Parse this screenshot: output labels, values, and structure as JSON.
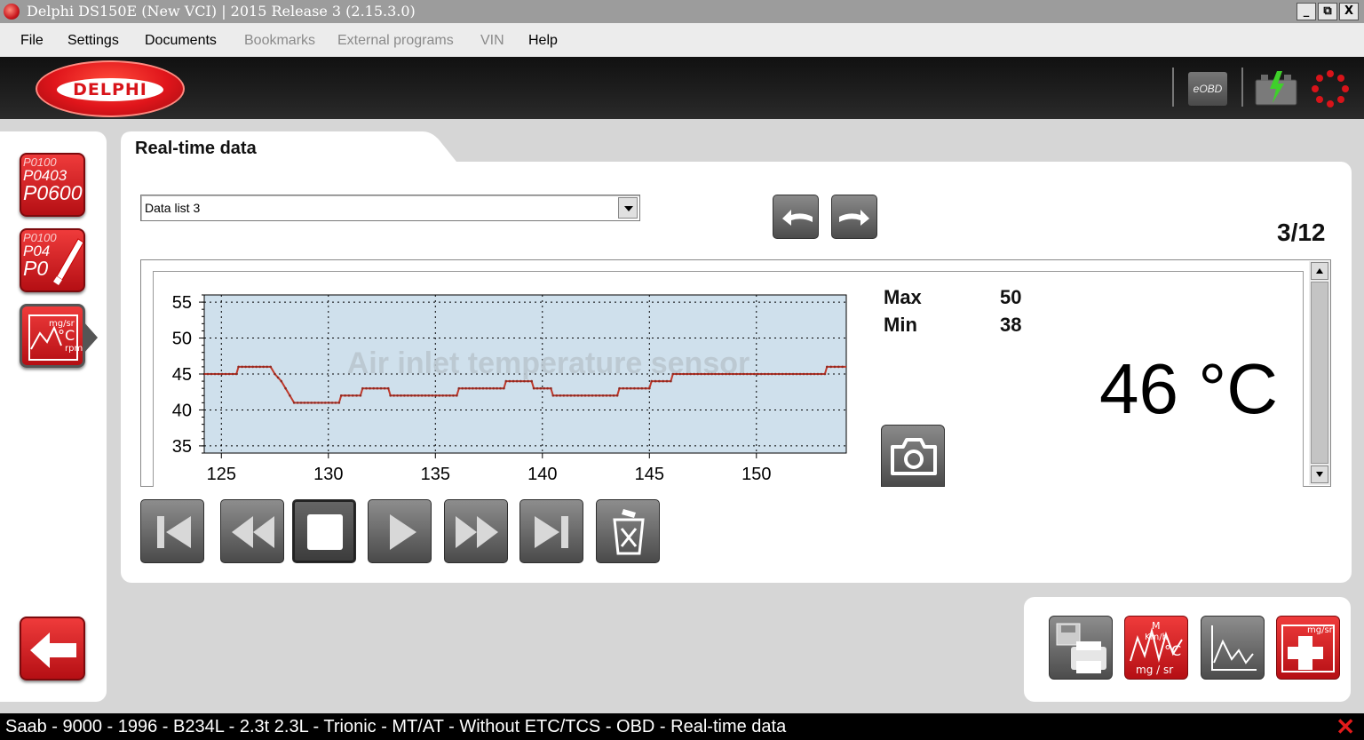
{
  "window": {
    "title": "Delphi DS150E (New VCI) | 2015 Release 3 (2.15.3.0)",
    "controls": [
      "_",
      "⧉",
      "X"
    ]
  },
  "menu": {
    "file": "File",
    "settings": "Settings",
    "documents": "Documents",
    "bookmarks": "Bookmarks",
    "external_programs": "External programs",
    "vin": "VIN",
    "help": "Help"
  },
  "header": {
    "logo_text": "DELPHI",
    "eobd_label": "eOBD"
  },
  "sidebar": {
    "dtc_button": {
      "codes": [
        "P0100",
        "P0403",
        "P0600"
      ]
    },
    "clear_dtc_button": {
      "codes": [
        "P0100",
        "P04",
        "P0"
      ]
    },
    "realtime_button": {
      "icon": "sensor-chart-icon"
    },
    "back_button": {
      "icon": "back-arrow-icon"
    }
  },
  "tab": {
    "title": "Real-time data"
  },
  "toolbar": {
    "data_list": "Data list 3",
    "page_counter": "3/12"
  },
  "sensor": {
    "name": "Air inlet temperature sensor",
    "max_label": "Max",
    "max_value": "50",
    "min_label": "Min",
    "min_value": "38",
    "current_value": "46 °C"
  },
  "chart_data": {
    "type": "line",
    "title": "Air inlet temperature sensor",
    "xlabel": "",
    "ylabel": "",
    "xlim": [
      124.2,
      154.2
    ],
    "ylim": [
      34,
      56
    ],
    "xticks": [
      125,
      130,
      135,
      140,
      145,
      150
    ],
    "yticks": [
      35,
      40,
      45,
      50,
      55
    ],
    "grid": true,
    "series": [
      {
        "color": "#c0392b",
        "points": [
          [
            124.2,
            45
          ],
          [
            125.7,
            45
          ],
          [
            125.8,
            46
          ],
          [
            127.3,
            46
          ],
          [
            127.5,
            45
          ],
          [
            127.8,
            44
          ],
          [
            128.0,
            43
          ],
          [
            128.2,
            42
          ],
          [
            128.4,
            41
          ],
          [
            130.5,
            41
          ],
          [
            130.6,
            42
          ],
          [
            131.5,
            42
          ],
          [
            131.6,
            43
          ],
          [
            132.8,
            43
          ],
          [
            132.9,
            42
          ],
          [
            136.0,
            42
          ],
          [
            136.1,
            43
          ],
          [
            138.2,
            43
          ],
          [
            138.3,
            44
          ],
          [
            139.5,
            44
          ],
          [
            139.6,
            43
          ],
          [
            140.4,
            43
          ],
          [
            140.5,
            42
          ],
          [
            143.5,
            42
          ],
          [
            143.6,
            43
          ],
          [
            145.0,
            43
          ],
          [
            145.1,
            44
          ],
          [
            146.0,
            44
          ],
          [
            146.1,
            45
          ],
          [
            153.2,
            45
          ],
          [
            153.3,
            46
          ],
          [
            154.2,
            46
          ]
        ]
      }
    ]
  },
  "tools": {
    "print_icon": "print-save-icon",
    "units_icon": "units-icon",
    "graph_icon": "graph-icon",
    "add_sensor_icon": "add-sensor-icon"
  },
  "status": {
    "text": "Saab - 9000 - 1996 - B234L - 2.3t 2.3L - Trionic - MT/AT - Without ETC/TCS - OBD - Real-time data",
    "close": "✕"
  },
  "colors": {
    "brand_red": "#d8141a",
    "chart_bg": "#cfe0ec",
    "trace": "#c0392b"
  }
}
